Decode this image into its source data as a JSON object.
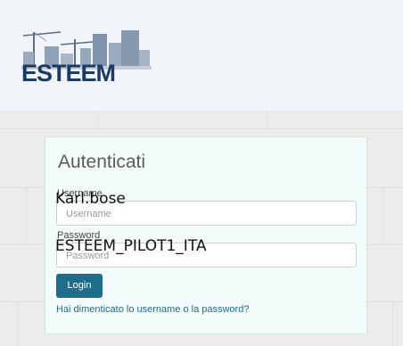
{
  "header": {
    "logo_text": "ESTEEM"
  },
  "login": {
    "title": "Autenticati",
    "username_label": "Username",
    "username_placeholder": "Username",
    "username_overlay": "Karl.bose",
    "password_label": "Password",
    "password_placeholder": "Password",
    "password_overlay": "ESTEEM_PILOT1_ITA",
    "login_button": "Login",
    "forgot_link": "Hai dimenticato lo username o la password?"
  },
  "colors": {
    "header_bg": "#f1f5fa",
    "logo_text": "#1b3a64",
    "button": "#1e6d8b",
    "link": "#1e6d8b"
  }
}
